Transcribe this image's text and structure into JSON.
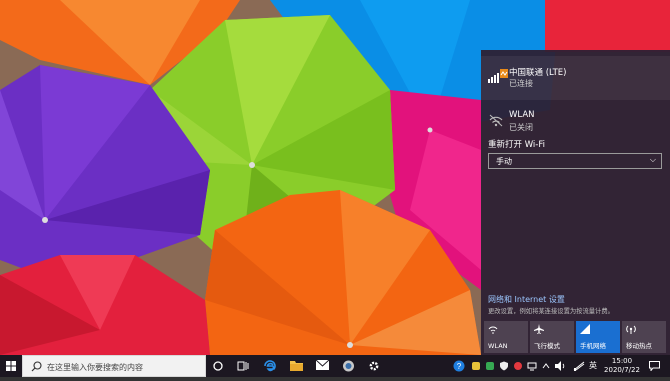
{
  "flyout": {
    "cellular": {
      "name": "中国联通 (LTE)",
      "status": "已连接"
    },
    "wlan": {
      "name": "WLAN",
      "status": "已关闭"
    },
    "wifi_reopen_label": "重新打开 Wi-Fi",
    "wifi_reopen_value": "手动",
    "settings_link": "网络和 Internet 设置",
    "settings_desc": "更改设置，例如将某连接设置为按流量计费。",
    "quick_actions": [
      {
        "label": "WLAN",
        "icon": "wifi-icon",
        "active": false
      },
      {
        "label": "飞行模式",
        "icon": "airplane-icon",
        "active": false
      },
      {
        "label": "手机网络",
        "icon": "cellular-signal-icon",
        "active": true
      },
      {
        "label": "移动热点",
        "icon": "hotspot-icon",
        "active": false
      }
    ]
  },
  "taskbar": {
    "search_placeholder": "在这里输入你要搜索的内容",
    "apps": [
      "task-view-icon",
      "edge-icon",
      "file-explorer-icon",
      "mail-icon",
      "app-icon",
      "settings-icon"
    ],
    "tray": {
      "ime": "英",
      "time": "15:00",
      "date": "2020/7/22"
    }
  },
  "colors": {
    "flyout_bg": "#2d2134",
    "accent": "#1a6fd1",
    "taskbar_bg": "#1c1721"
  }
}
